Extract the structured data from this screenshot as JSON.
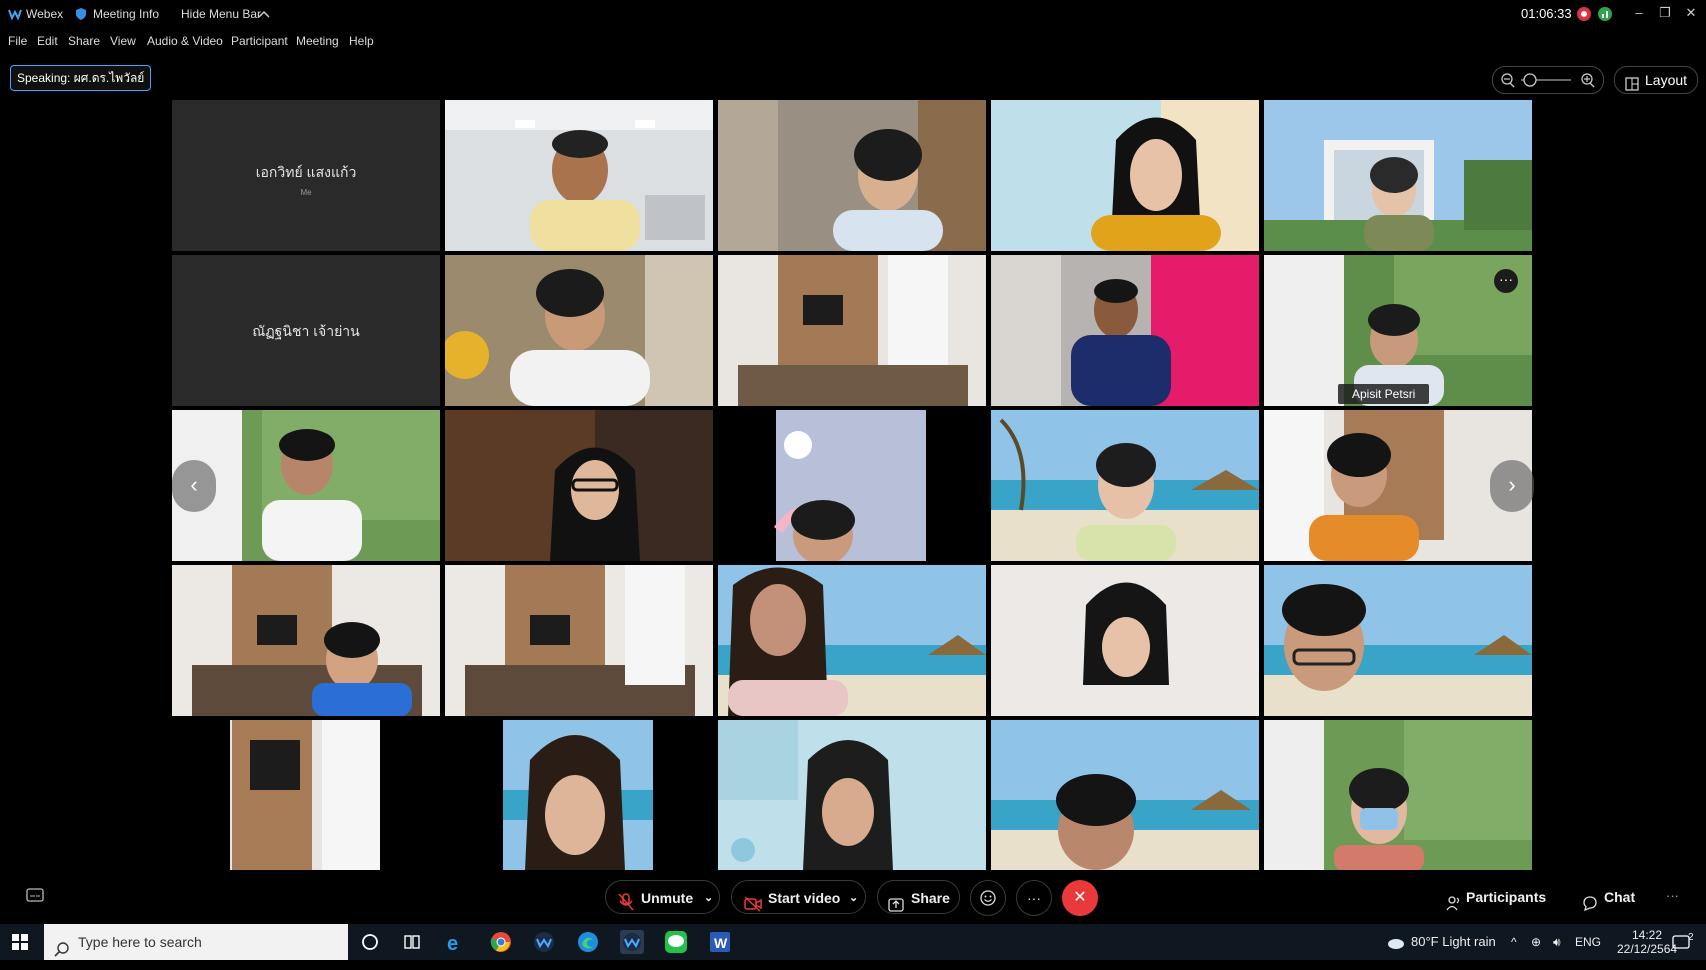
{
  "titlebar": {
    "app_name": "Webex",
    "meeting_info": "Meeting Info",
    "hide_menu_bar": "Hide Menu Bar",
    "timer": "01:06:33"
  },
  "menu": [
    "File",
    "Edit",
    "Share",
    "View",
    "Audio & Video",
    "Participant",
    "Meeting",
    "Help"
  ],
  "speaking": "Speaking: ผศ.ดร.ไพวัลย์",
  "layout_label": "Layout",
  "tiles": {
    "self_name": "เอกวิทย์ แสงแก้ว",
    "self_me": "Me",
    "name_tile_2": "ณัฏฐนิชา เจ้าย่าน",
    "apisit_label": "Apisit Petsri",
    "more_label": "···"
  },
  "controls": {
    "unmute": "Unmute",
    "start_video": "Start video",
    "share": "Share",
    "more": "···",
    "participants": "Participants",
    "chat": "Chat",
    "overflow": "···"
  },
  "taskbar": {
    "search_placeholder": "Type here to search",
    "weather": "80°F  Light rain",
    "lang": "ENG",
    "time": "14:22",
    "date": "22/12/2564",
    "notif_count": "2"
  },
  "colors": {
    "accent_blue": "#4aa3ff",
    "end_red": "#e83a3a",
    "record_red": "#e03040",
    "tile_gray": "#2a2a2a"
  }
}
